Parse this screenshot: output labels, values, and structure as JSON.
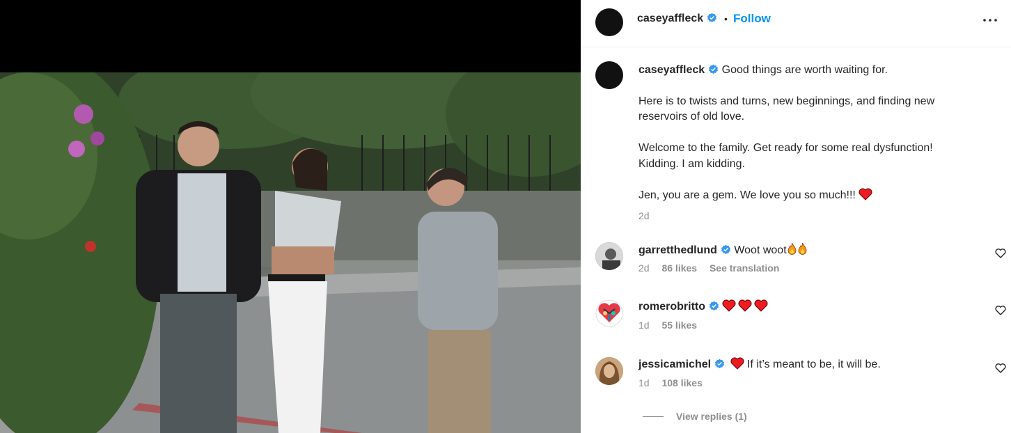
{
  "header": {
    "username": "caseyaffleck",
    "separator": "•",
    "follow_label": "Follow",
    "more_icon": "more-options-icon"
  },
  "caption": {
    "username": "caseyaffleck",
    "line1": "Good things are worth waiting for.",
    "para2": "Here is to twists and turns, new beginnings, and finding new reservoirs of old love.",
    "para3": "Welcome to the family. Get ready for some real dysfunction! Kidding. I am kidding.",
    "para4": "Jen, you are a gem. We love you so much!!!",
    "emoji": "heart-icon",
    "time": "2d"
  },
  "comments": [
    {
      "username": "garretthedlund",
      "text": "Woot woot",
      "emoji": "fire-icon",
      "time": "2d",
      "likes": "86 likes",
      "translate_label": "See translation"
    },
    {
      "username": "romerobritto",
      "text": "",
      "emoji": "heart-icon",
      "time": "1d",
      "likes": "55 likes"
    },
    {
      "username": "jessicamichel",
      "text": "If it’s meant to be, it will be.",
      "emoji": "heart-icon",
      "time": "1d",
      "likes": "108 likes"
    }
  ],
  "view_replies_label": "View replies (1)",
  "colors": {
    "accent": "#0095f6",
    "verified": "#3897f0",
    "heart": "#ed1c24",
    "muted_text": "#8e8e8e"
  }
}
